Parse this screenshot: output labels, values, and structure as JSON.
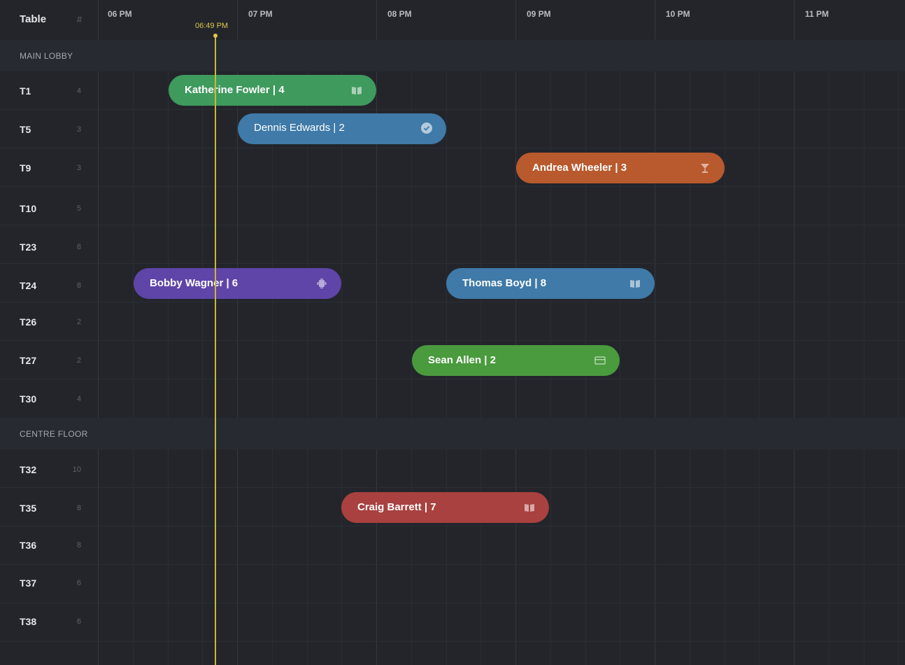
{
  "header": {
    "table_label": "Table",
    "count_label": "#",
    "hours": [
      "06 PM",
      "07 PM",
      "08 PM",
      "09 PM",
      "10 PM",
      "11 PM"
    ]
  },
  "now": {
    "time_label": "06:49 PM"
  },
  "sections": [
    {
      "name": "MAIN LOBBY",
      "tables": [
        {
          "name": "T1",
          "capacity": "4"
        },
        {
          "name": "T5",
          "capacity": "3"
        },
        {
          "name": "T9",
          "capacity": "3"
        },
        {
          "name": "T10",
          "capacity": "5"
        },
        {
          "name": "T23",
          "capacity": "8"
        },
        {
          "name": "T24",
          "capacity": "8"
        },
        {
          "name": "T26",
          "capacity": "2"
        },
        {
          "name": "T27",
          "capacity": "2"
        },
        {
          "name": "T30",
          "capacity": "4"
        }
      ]
    },
    {
      "name": "CENTRE FLOOR",
      "tables": [
        {
          "name": "T32",
          "capacity": "10"
        },
        {
          "name": "T35",
          "capacity": "8"
        },
        {
          "name": "T36",
          "capacity": "8"
        },
        {
          "name": "T37",
          "capacity": "6"
        },
        {
          "name": "T38",
          "capacity": "6"
        }
      ]
    }
  ],
  "bookings": [
    {
      "label": "Katherine Fowler  |  4",
      "color": "#3f9a5e",
      "icon": "book-icon"
    },
    {
      "label": "Dennis Edwards  |  2",
      "color": "#3f7aa8",
      "icon": "check-circle-icon"
    },
    {
      "label": "Andrea Wheeler  |  3",
      "color": "#b85a2e",
      "icon": "cocktail-icon"
    },
    {
      "label": "Bobby Wagner  |  6",
      "color": "#5f45a8",
      "icon": "chair-icon"
    },
    {
      "label": "Thomas Boyd  |  8",
      "color": "#3f7aa8",
      "icon": "book-icon"
    },
    {
      "label": "Sean Allen  |  2",
      "color": "#4a9a3e",
      "icon": "card-icon"
    },
    {
      "label": "Craig Barrett  |  7",
      "color": "#a8413f",
      "icon": "book-icon"
    }
  ]
}
